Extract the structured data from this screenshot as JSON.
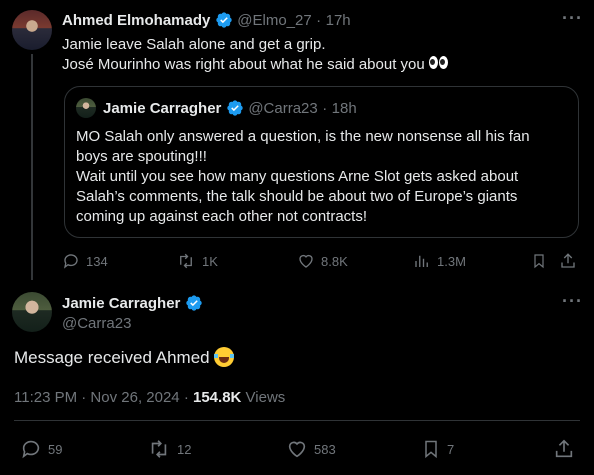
{
  "tweet": {
    "author_name": "Ahmed Elmohamady",
    "author_handle": "@Elmo_27",
    "time": "17h",
    "separator": "·",
    "more_label": "···",
    "text_line1": "Jamie leave Salah alone and get a grip.",
    "text_line2": "José Mourinho was right about what he said about you",
    "emoji": "eyes-emoji",
    "quote": {
      "author_name": "Jamie Carragher",
      "author_handle": "@Carra23",
      "time": "18h",
      "separator": "·",
      "line1": "MO Salah only answered a question, is the new nonsense all his fan",
      "line2": "boys are spouting!!!",
      "line3": "Wait until you see how many questions Arne Slot gets asked about",
      "line4": "Salah’s comments, the talk should be about two of Europe’s giants",
      "line5": "coming up against each other not contracts!"
    },
    "actions": {
      "replies": "134",
      "reposts": "1K",
      "likes": "8.8K",
      "views": "1.3M"
    }
  },
  "reply": {
    "author_name": "Jamie Carragher",
    "author_handle": "@Carra23",
    "more_label": "···",
    "text": "Message received Ahmed",
    "emoji": "tears-of-joy-emoji",
    "timestamp": "11:23 PM · Nov 26, 2024 ·",
    "views_count": "154.8K",
    "views_label": "Views",
    "actions": {
      "replies": "59",
      "reposts": "12",
      "likes": "583",
      "bookmarks": "7"
    }
  },
  "colors": {
    "background": "#000000",
    "text": "#e7e9ea",
    "muted": "#71767b",
    "verified": "#1d9bf0",
    "border": "#2f3336"
  }
}
